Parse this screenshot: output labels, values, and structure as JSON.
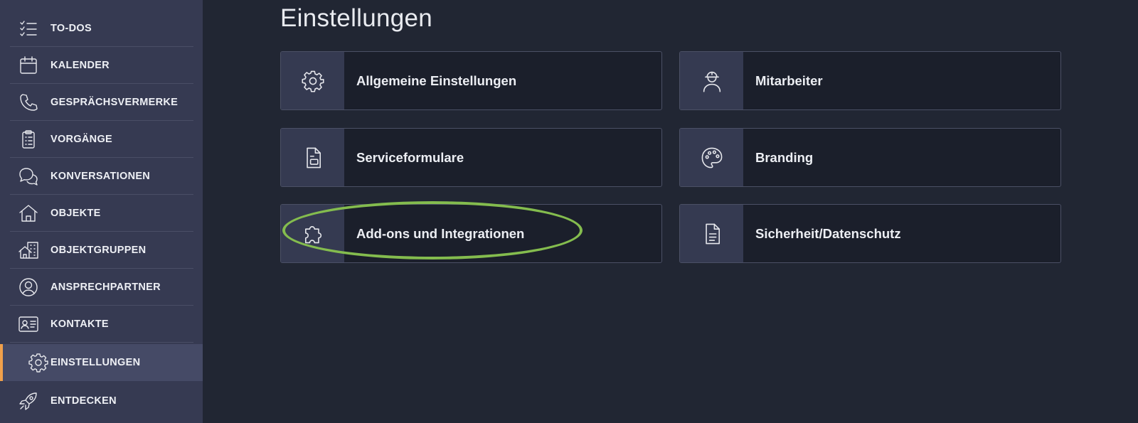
{
  "sidebar": {
    "items": [
      {
        "label": "TO-DOS",
        "icon": "todo-list-icon"
      },
      {
        "label": "KALENDER",
        "icon": "calendar-icon"
      },
      {
        "label": "GESPRÄCHSVERMERKE",
        "icon": "phone-icon"
      },
      {
        "label": "VORGÄNGE",
        "icon": "clipboard-icon"
      },
      {
        "label": "KONVERSATIONEN",
        "icon": "chat-bubbles-icon"
      },
      {
        "label": "OBJEKTE",
        "icon": "house-icon"
      },
      {
        "label": "OBJEKTGRUPPEN",
        "icon": "building-group-icon"
      },
      {
        "label": "ANSPRECHPARTNER",
        "icon": "user-circle-icon"
      },
      {
        "label": "KONTAKTE",
        "icon": "contact-card-icon"
      },
      {
        "label": "EINSTELLUNGEN",
        "icon": "gear-icon",
        "active": true
      },
      {
        "label": "ENTDECKEN",
        "icon": "rocket-icon"
      }
    ],
    "active_accent": "#f0a04b"
  },
  "main": {
    "title": "Einstellungen",
    "cards": [
      {
        "label": "Allgemeine Einstellungen",
        "icon": "gear-icon"
      },
      {
        "label": "Mitarbeiter",
        "icon": "worker-icon"
      },
      {
        "label": "Serviceformulare",
        "icon": "form-document-icon"
      },
      {
        "label": "Branding",
        "icon": "palette-icon"
      },
      {
        "label": "Add-ons und Integrationen",
        "icon": "puzzle-icon",
        "highlighted": true
      },
      {
        "label": "Sicherheit/Datenschutz",
        "icon": "document-lines-icon"
      }
    ]
  },
  "colors": {
    "background": "#212633",
    "sidebar": "#363a52",
    "highlight": "#84bc4e"
  }
}
